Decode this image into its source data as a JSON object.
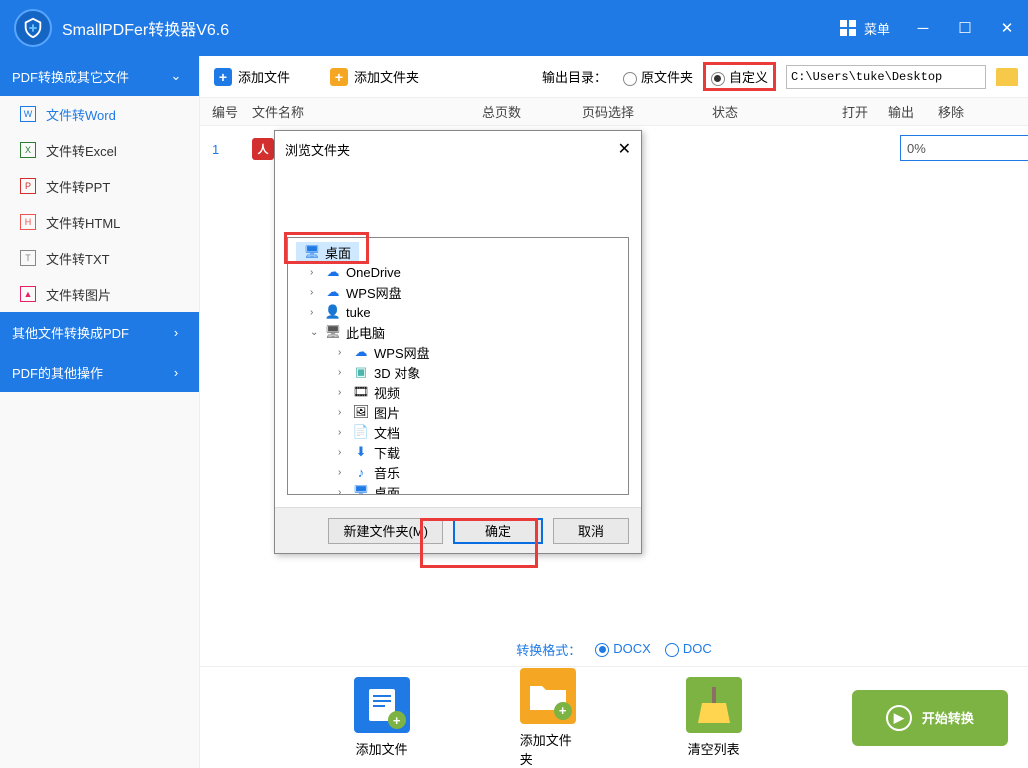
{
  "app": {
    "title": "SmallPDFer转换器V6.6",
    "menu": "菜单"
  },
  "toolbar": {
    "addFile": "添加文件",
    "addFolder": "添加文件夹",
    "outputLabel": "输出目录：",
    "radioOriginal": "原文件夹",
    "radioCustom": "自定义",
    "path": "C:\\Users\\tuke\\Desktop"
  },
  "sidebar": {
    "section1": "PDF转换成其它文件",
    "items": [
      "文件转Word",
      "文件转Excel",
      "文件转PPT",
      "文件转HTML",
      "文件转TXT",
      "文件转图片"
    ],
    "section2": "其他文件转换成PDF",
    "section3": "PDF的其他操作"
  },
  "table": {
    "headers": {
      "num": "编号",
      "name": "文件名称",
      "pages": "总页数",
      "range": "页码选择",
      "status": "状态",
      "open": "打开",
      "out": "输出",
      "del": "移除"
    },
    "row": {
      "num": "1",
      "progress": "0%"
    }
  },
  "dialog": {
    "title": "浏览文件夹",
    "tree": {
      "desktop": "桌面",
      "onedrive": "OneDrive",
      "wps": "WPS网盘",
      "user": "tuke",
      "thispc": "此电脑",
      "wps2": "WPS网盘",
      "threed": "3D 对象",
      "video": "视频",
      "pictures": "图片",
      "docs": "文档",
      "downloads": "下载",
      "music": "音乐",
      "desktop2": "桌面"
    },
    "newFolder": "新建文件夹(M)",
    "ok": "确定",
    "cancel": "取消"
  },
  "format": {
    "label": "转换格式：",
    "docx": "DOCX",
    "doc": "DOC"
  },
  "bottom": {
    "addFile": "添加文件",
    "addFolder": "添加文件夹",
    "clear": "清空列表",
    "start": "开始转换"
  }
}
